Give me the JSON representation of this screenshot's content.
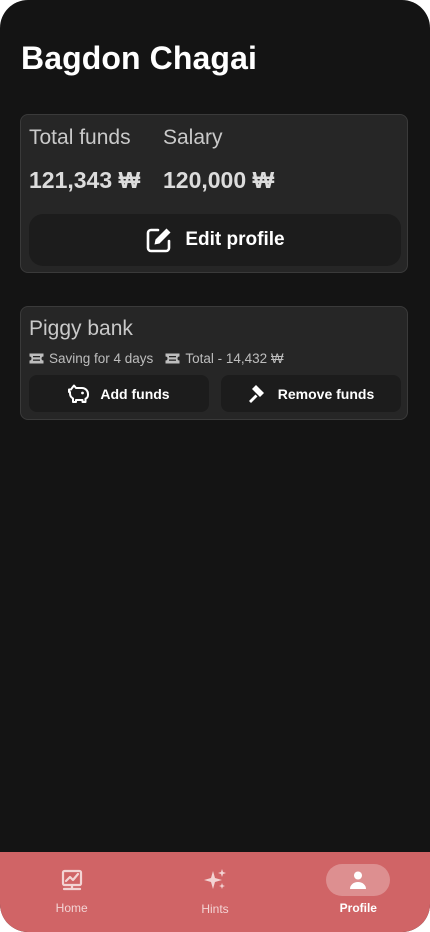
{
  "user": {
    "name": "Bagdon Chagai"
  },
  "funds_card": {
    "total_funds_label": "Total funds",
    "total_funds_value": "121,343 ₩",
    "salary_label": "Salary",
    "salary_value": "120,000 ₩",
    "edit_button_label": "Edit profile",
    "edit_icon": "edit-square-icon"
  },
  "piggy_bank": {
    "title": "Piggy bank",
    "saving_text": "Saving for 4 days",
    "total_text": "Total - 14,432 ₩",
    "saving_icon": "ticket-icon",
    "total_icon": "ticket-icon",
    "add_funds_label": "Add funds",
    "add_funds_icon": "piggy-bank-icon",
    "remove_funds_label": "Remove funds",
    "remove_funds_icon": "hammer-icon"
  },
  "nav": {
    "items": [
      {
        "label": "Home",
        "icon": "chart-board-icon",
        "active": false
      },
      {
        "label": "Hints",
        "icon": "sparkles-icon",
        "active": false
      },
      {
        "label": "Profile",
        "icon": "person-icon",
        "active": true
      }
    ]
  },
  "colors": {
    "background": "#141414",
    "card": "#262626",
    "button": "#1c1c1c",
    "nav_bar": "#d06466"
  }
}
